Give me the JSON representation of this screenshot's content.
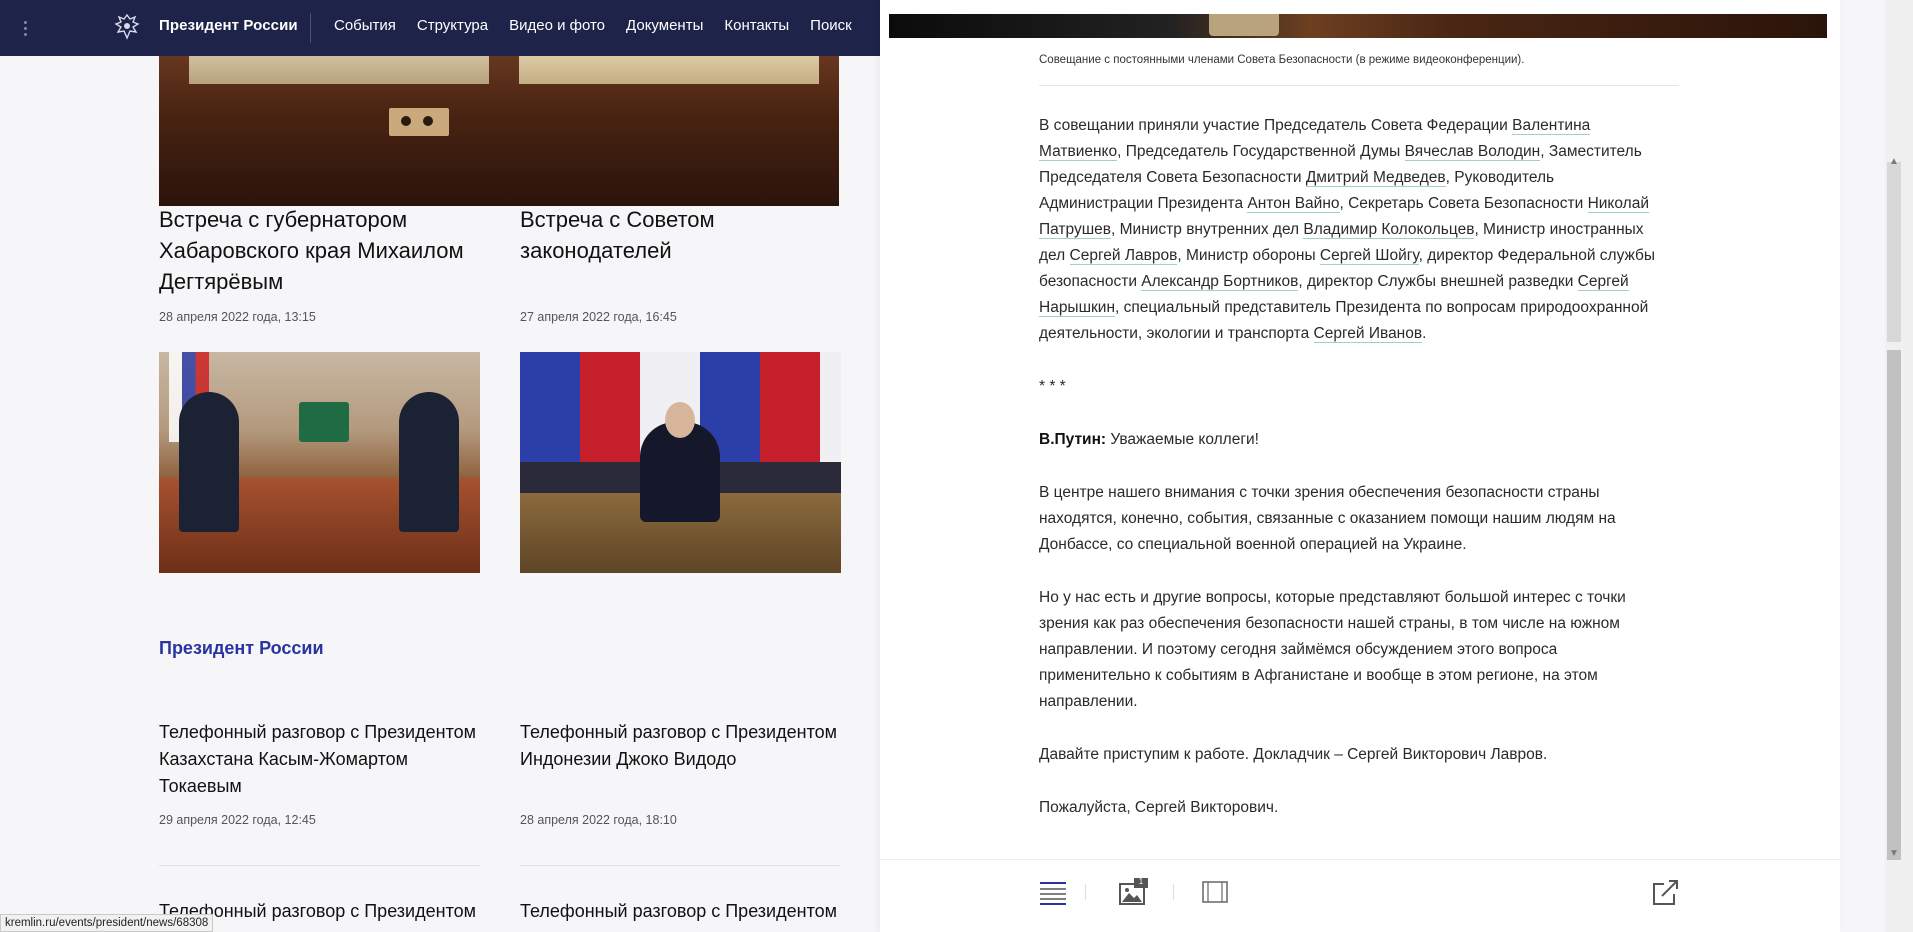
{
  "nav": {
    "brand": "Президент России",
    "menu": [
      "События",
      "Структура",
      "Видео и фото",
      "Документы",
      "Контакты",
      "Поиск"
    ]
  },
  "left": {
    "news": [
      {
        "title_lines": [
          "Встреча с губернатором",
          "Хабаровского края Михаилом",
          "Дегтярёвым"
        ],
        "date": "28 апреля 2022 года, 13:15"
      },
      {
        "title_lines": [
          "Встреча с Советом",
          "законодателей"
        ],
        "date": "27 апреля 2022 года, 16:45"
      }
    ],
    "section_title": "Президент России",
    "phone_calls": [
      {
        "title_lines": [
          "Телефонный разговор с Президентом",
          "Казахстана Касым-Жомартом",
          "Токаевым"
        ],
        "date": "29 апреля 2022 года, 12:45"
      },
      {
        "title_lines": [
          "Телефонный разговор с Президентом",
          "Индонезии Джоко Видодо"
        ],
        "date": "28 апреля 2022 года, 18:10"
      },
      {
        "title_lines": [
          "Телефонный разговор с Президентом"
        ]
      },
      {
        "title_lines": [
          "Телефонный разговор с Президентом"
        ]
      }
    ]
  },
  "status_url": "kremlin.ru/events/president/news/68308",
  "article": {
    "caption": "Совещание с постоянными членами Совета Безопасности (в режиме видеоконференции).",
    "p1": {
      "t1": "В совещании приняли участие Председатель Совета Федерации ",
      "l1": "Валентина Матвиенко",
      "t2": ", Председатель Государственной Думы ",
      "l2": "Вячеслав Володин",
      "t3": ", Заместитель Председателя Совета Безопасности ",
      "l3": "Дмитрий Медведев",
      "t4": ", Руководитель Администрации Президента ",
      "l4": "Антон Вайно",
      "t5": ", Секретарь Совета Безопасности ",
      "l5": "Николай Патрушев",
      "t6": ", Министр внутренних дел ",
      "l6": "Владимир Колокольцев",
      "t7": ", Министр иностранных дел ",
      "l7": "Сергей Лавров",
      "t8": ", Министр обороны ",
      "l8": "Сергей Шойгу",
      "t9": ", директор Федеральной службы безопасности ",
      "l9": "Александр Бортников",
      "t10": ", директор Службы внешней разведки ",
      "l10": "Сергей Нарышкин",
      "t11": ", специальный представитель Президента по вопросам природоохранной деятельности, экологии и транспорта ",
      "l11": "Сергей Иванов",
      "t12": "."
    },
    "stars": "* * *",
    "speaker": "В.Путин:",
    "p2": " Уважаемые коллеги!",
    "p3": "В центре нашего внимания с точки зрения обеспечения безопасности страны находятся, конечно, события, связанные с оказанием помощи нашим людям на Донбассе, со специальной военной операцией на Украине.",
    "p4": "Но у нас есть и другие вопросы, которые представляют большой интерес с точки зрения как раз обеспечения безопасности нашей страны, в том числе на южном направлении. И поэтому сегодня займёмся обсуждением этого вопроса применительно к событиям в Афганистане и вообще в этом регионе, на этом направлении.",
    "p5": "Давайте приступим к работе. Докладчик – Сергей Викторович Лавров.",
    "p6": "Пожалуйста, Сергей Викторович.",
    "photo_badge": "1"
  }
}
